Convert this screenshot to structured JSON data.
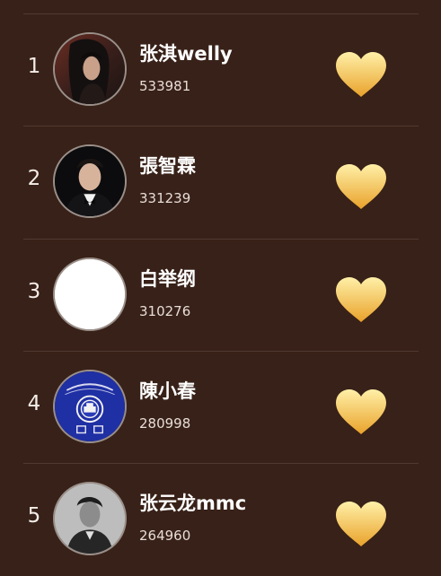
{
  "colors": {
    "background": "#382118",
    "divider": "#4e3a32",
    "heart_top": "#fff0a8",
    "heart_bottom": "#e9a22a"
  },
  "ranking": [
    {
      "rank": "1",
      "name": "张淇welly",
      "score": "533981",
      "avatar": "photo-long-hair-man"
    },
    {
      "rank": "2",
      "name": "張智霖",
      "score": "331239",
      "avatar": "photo-man-bow-tie"
    },
    {
      "rank": "3",
      "name": "白举纲",
      "score": "310276",
      "avatar": "blank-white"
    },
    {
      "rank": "4",
      "name": "陳小春",
      "score": "280998",
      "avatar": "hong-kong-passport-emblem"
    },
    {
      "rank": "5",
      "name": "张云龙mmc",
      "score": "264960",
      "avatar": "photo-black-white-man"
    }
  ],
  "icons": {
    "like": "heart-icon"
  }
}
